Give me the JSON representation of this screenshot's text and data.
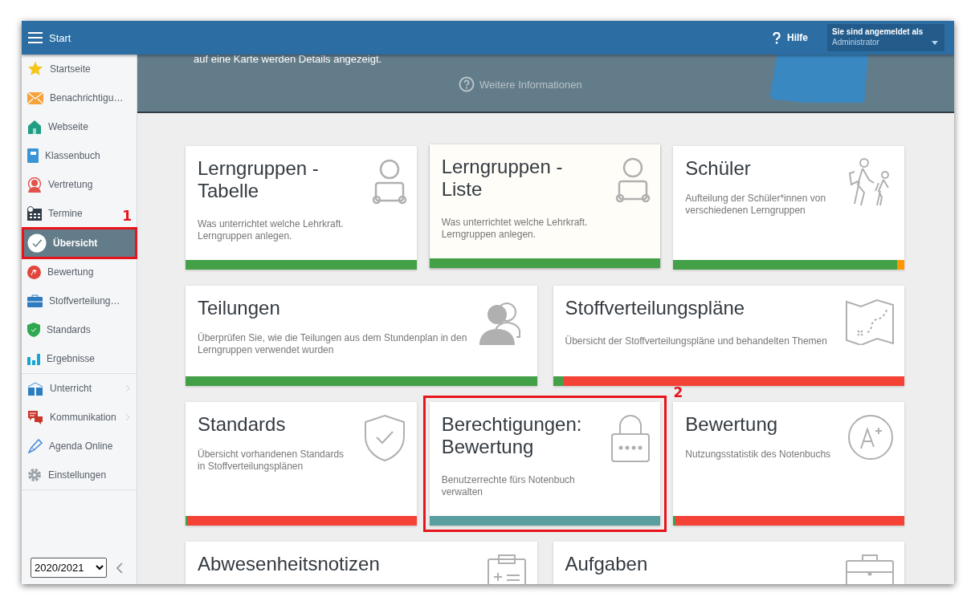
{
  "topbar": {
    "title": "Start",
    "help": "Hilfe",
    "login": {
      "caption": "Sie sind angemeldet als",
      "user": "Administrator"
    }
  },
  "sidebar": {
    "groups": [
      [
        {
          "label": "Startseite",
          "selected": false
        },
        {
          "label": "Benachrichtigu…",
          "selected": false
        },
        {
          "label": "Webseite",
          "selected": false
        },
        {
          "label": "Klassenbuch",
          "selected": false
        },
        {
          "label": "Vertretung",
          "selected": false
        },
        {
          "label": "Termine",
          "selected": false
        }
      ],
      [
        {
          "label": "Übersicht",
          "selected": true,
          "callout": "1"
        },
        {
          "label": "Bewertung",
          "selected": false
        },
        {
          "label": "Stoffverteilung…",
          "selected": false
        },
        {
          "label": "Standards",
          "selected": false
        },
        {
          "label": "Ergebnisse",
          "selected": false
        }
      ],
      [
        {
          "label": "Unterricht",
          "selected": false,
          "submenu": true
        },
        {
          "label": "Kommunikation",
          "selected": false,
          "submenu": true
        },
        {
          "label": "Agenda Online",
          "selected": false
        },
        {
          "label": "Einstellungen",
          "selected": false
        }
      ]
    ],
    "year": "2020/2021"
  },
  "banner": {
    "text": "auf eine Karte werden Details angezeigt.",
    "link": "Weitere Informationen"
  },
  "card_rows": [
    [
      {
        "title": "Lerngruppen - Tabelle",
        "description": "Was unterrichtet welche Lehrkraft. Lerngruppen anlegen.",
        "highlighted": false,
        "bar": {
          "kind": "progress",
          "level": 1
        }
      },
      {
        "title": "Lerngruppen - Liste",
        "description": "Was unterrichtet welche Lehrkraft. Lerngruppen anlegen.",
        "highlighted": true,
        "bar": {
          "kind": "progress",
          "level": 1
        }
      },
      {
        "title": "Schüler",
        "description": "Aufteilung der Schüler*innen von verschiedenen Lerngruppen",
        "highlighted": false,
        "bar": {
          "kind": "progress",
          "level": 0.97,
          "color": "#ff9800"
        }
      }
    ],
    [
      {
        "title": "Teilungen",
        "description": "Überprüfen Sie, wie die Teilungen aus dem Stundenplan in den Lerngruppen verwendet wurden",
        "highlighted": false,
        "bar": {
          "kind": "progress",
          "level": 1
        }
      },
      {
        "title": "Stoffverteilungspläne",
        "description": "Übersicht der Stoffverteilungspläne und behandelten Themen",
        "highlighted": false,
        "bar": {
          "kind": "progress",
          "level": 0.03,
          "color": "#f44336"
        }
      }
    ],
    [
      {
        "title": "Standards",
        "description": "Übersicht vorhandenen Standards in Stoffverteilungsplänen",
        "highlighted": false,
        "bar": {
          "kind": "progress",
          "level": 0.01,
          "color": "#f44336"
        }
      },
      {
        "title": "Berechtigungen: Bewertung",
        "description": "Benutzerrechte fürs Notenbuch verwalten",
        "highlighted": false,
        "callout": "2",
        "bar": {
          "kind": "plain",
          "color": "#5b9ea0"
        }
      },
      {
        "title": "Bewertung",
        "description": "Nutzungsstatistik des Notenbuchs",
        "highlighted": false,
        "bar": {
          "kind": "progress",
          "level": 0.01,
          "color": "#f44336"
        }
      }
    ],
    [
      {
        "title": "Abwesenheitsnotizen",
        "highlighted": false
      },
      {
        "title": "Aufgaben",
        "highlighted": false
      }
    ]
  ]
}
